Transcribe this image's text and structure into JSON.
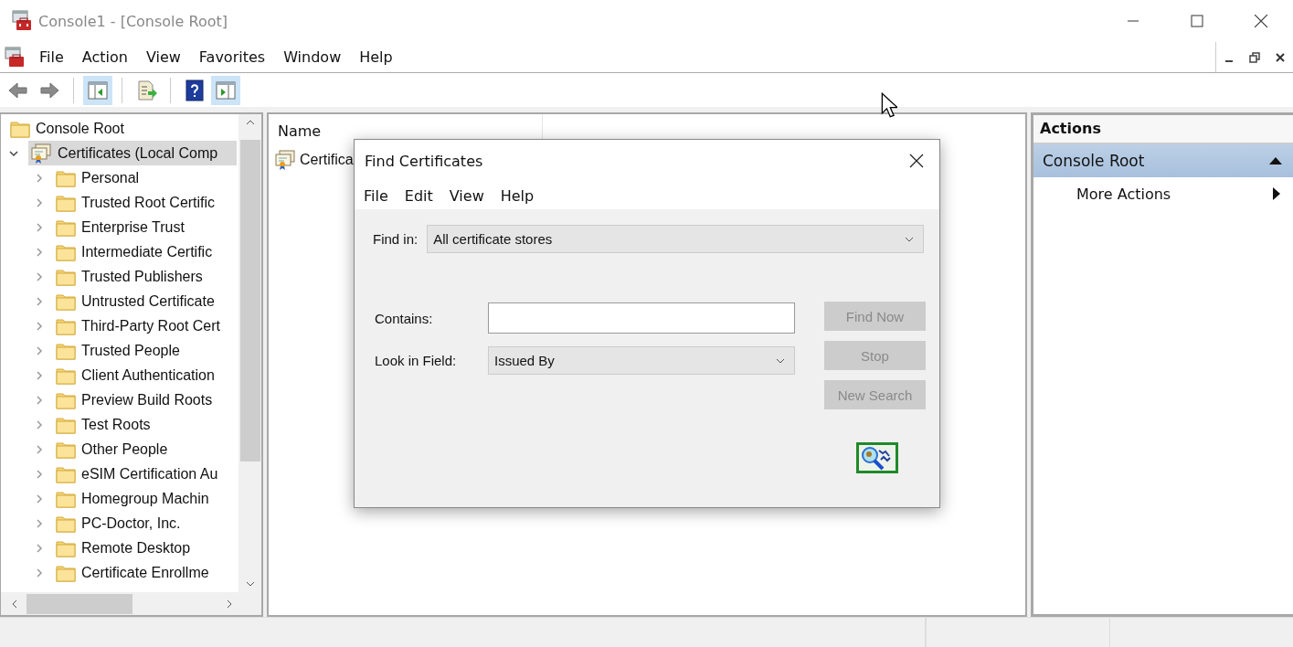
{
  "window": {
    "title": "Console1 - [Console Root]"
  },
  "menu": [
    "File",
    "Action",
    "View",
    "Favorites",
    "Window",
    "Help"
  ],
  "toolbar": [
    {
      "kind": "back",
      "pressed": false
    },
    {
      "kind": "forward",
      "pressed": false
    },
    {
      "kind": "tree-toggle",
      "pressed": true
    },
    {
      "kind": "export",
      "pressed": false
    },
    {
      "kind": "help",
      "pressed": false
    },
    {
      "kind": "action-toggle",
      "pressed": true
    }
  ],
  "tree": {
    "items": [
      {
        "label": "Console Root",
        "kind": "folder",
        "selected": false,
        "children": [
          {
            "label": "Certificates (Local Comp",
            "kind": "certificates",
            "expanded": true,
            "selected": true,
            "children": [
              {
                "label": "Personal",
                "kind": "folder",
                "expanded": false,
                "selected": false
              },
              {
                "label": "Trusted Root Certific",
                "kind": "folder",
                "expanded": false,
                "selected": false
              },
              {
                "label": "Enterprise Trust",
                "kind": "folder",
                "expanded": false,
                "selected": false
              },
              {
                "label": "Intermediate Certific",
                "kind": "folder",
                "expanded": false,
                "selected": false
              },
              {
                "label": "Trusted Publishers",
                "kind": "folder",
                "expanded": false,
                "selected": false
              },
              {
                "label": "Untrusted Certificate",
                "kind": "folder",
                "expanded": false,
                "selected": false
              },
              {
                "label": "Third-Party Root Cert",
                "kind": "folder",
                "expanded": false,
                "selected": false
              },
              {
                "label": "Trusted People",
                "kind": "folder",
                "expanded": false,
                "selected": false
              },
              {
                "label": "Client Authentication",
                "kind": "folder",
                "expanded": false,
                "selected": false
              },
              {
                "label": "Preview Build Roots",
                "kind": "folder",
                "expanded": false,
                "selected": false
              },
              {
                "label": "Test Roots",
                "kind": "folder",
                "expanded": false,
                "selected": false
              },
              {
                "label": "Other People",
                "kind": "folder",
                "expanded": false,
                "selected": false
              },
              {
                "label": "eSIM Certification Au",
                "kind": "folder",
                "expanded": false,
                "selected": false
              },
              {
                "label": "Homegroup Machin",
                "kind": "folder",
                "expanded": false,
                "selected": false
              },
              {
                "label": "PC-Doctor, Inc.",
                "kind": "folder",
                "expanded": false,
                "selected": false
              },
              {
                "label": "Remote Desktop",
                "kind": "folder",
                "expanded": false,
                "selected": false
              },
              {
                "label": "Certificate Enrollme",
                "kind": "folder",
                "expanded": false,
                "selected": false
              }
            ]
          }
        ]
      }
    ]
  },
  "list": {
    "columns": [
      "Name"
    ],
    "rows": [
      {
        "name": "Certifica"
      }
    ]
  },
  "actions": {
    "title": "Actions",
    "sections": [
      {
        "label": "Console Root",
        "expanded": true,
        "items": [
          {
            "label": "More Actions",
            "submenu": true
          }
        ]
      }
    ]
  },
  "dialog": {
    "title": "Find Certificates",
    "menu": [
      "File",
      "Edit",
      "View",
      "Help"
    ],
    "find_in": {
      "label": "Find in:",
      "value": "All certificate stores"
    },
    "contains": {
      "label": "Contains:"
    },
    "look_in_field": {
      "label": "Look in Field:",
      "value": "Issued By"
    },
    "buttons": [
      {
        "label": "Find Now",
        "disabled": true
      },
      {
        "label": "Stop",
        "disabled": true
      },
      {
        "label": "New Search",
        "disabled": true
      }
    ]
  }
}
